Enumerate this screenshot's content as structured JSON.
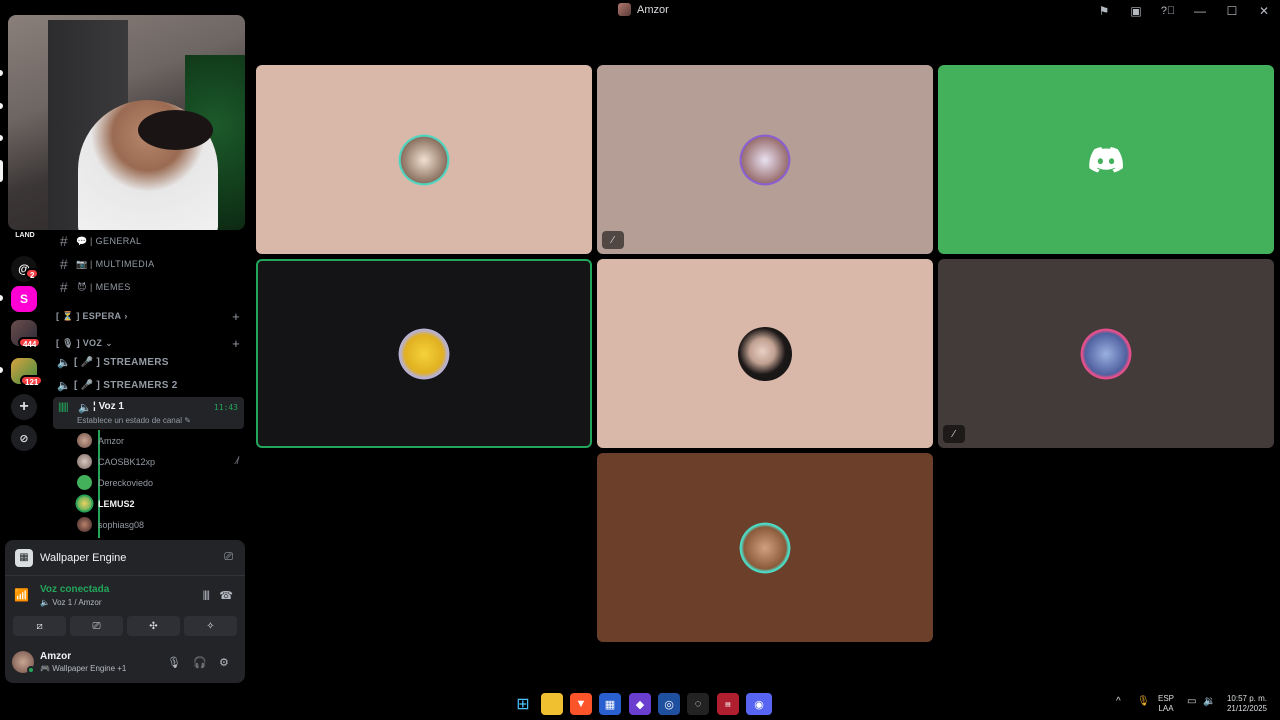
{
  "window": {
    "title": "Amzor"
  },
  "titlebar_icons": [
    "inbox-flag-icon",
    "window-icon",
    "help-icon",
    "minimize-icon",
    "maximize-icon",
    "close-icon"
  ],
  "rail": {
    "server_label": "LAND",
    "badges": [
      "2",
      "444",
      "121"
    ]
  },
  "channels": [
    {
      "emoji": "💬",
      "label": "| GENERAL"
    },
    {
      "emoji": "📷",
      "label": "| MULTIMEDIA"
    },
    {
      "emoji": "😈",
      "label": "| MEMES"
    }
  ],
  "categories": {
    "espera": "[ ⏳ ] ESPERA",
    "voz": "[ 🎙 ] VOZ"
  },
  "voice_channels": [
    {
      "label": "[ 🎤 ] STREAMERS"
    },
    {
      "label": "[ 🎤 ] STREAMERS 2"
    }
  ],
  "active_channel": {
    "name": "¦ Voz 1",
    "time": "11:43",
    "status": "Establece un estado de canal"
  },
  "members": [
    {
      "name": "Amzor",
      "muted": false,
      "bold": false
    },
    {
      "name": "CAOSBK12xp",
      "muted": true,
      "bold": false
    },
    {
      "name": "Dereckoviedo",
      "muted": false,
      "bold": false
    },
    {
      "name": "LEMUS2",
      "muted": false,
      "bold": true
    },
    {
      "name": "sophiasg08",
      "muted": false,
      "bold": false
    }
  ],
  "panel": {
    "activity": "Wallpaper Engine",
    "voice_status": "Voz conectada",
    "voice_location": "Voz 1 / Amzor",
    "user": {
      "name": "Amzor",
      "status": "Wallpaper Engine +1"
    }
  },
  "video_tiles": [
    {
      "bg": "#d9b8a9",
      "avatar": "avatar-1",
      "muted": false,
      "speaking": false
    },
    {
      "bg": "#b49e95",
      "avatar": "avatar-2",
      "muted": true,
      "speaking": false
    },
    {
      "bg": "#43b05c",
      "avatar": "discord-default",
      "muted": false,
      "speaking": false
    },
    {
      "bg": "#141416",
      "avatar": "avatar-bee",
      "muted": false,
      "speaking": true
    },
    {
      "bg": "#d9b8a9",
      "avatar": "avatar-girl",
      "muted": false,
      "speaking": false
    },
    {
      "bg": "#433a3a",
      "avatar": "avatar-sign",
      "muted": true,
      "speaking": false
    },
    {
      "bg": "#6b3f2a",
      "avatar": "avatar-dog",
      "muted": false,
      "speaking": false
    }
  ],
  "taskbar": {
    "lang_top": "ESP",
    "lang_bottom": "LAA",
    "time": "10:57 p. m.",
    "date": "21/12/2025"
  }
}
